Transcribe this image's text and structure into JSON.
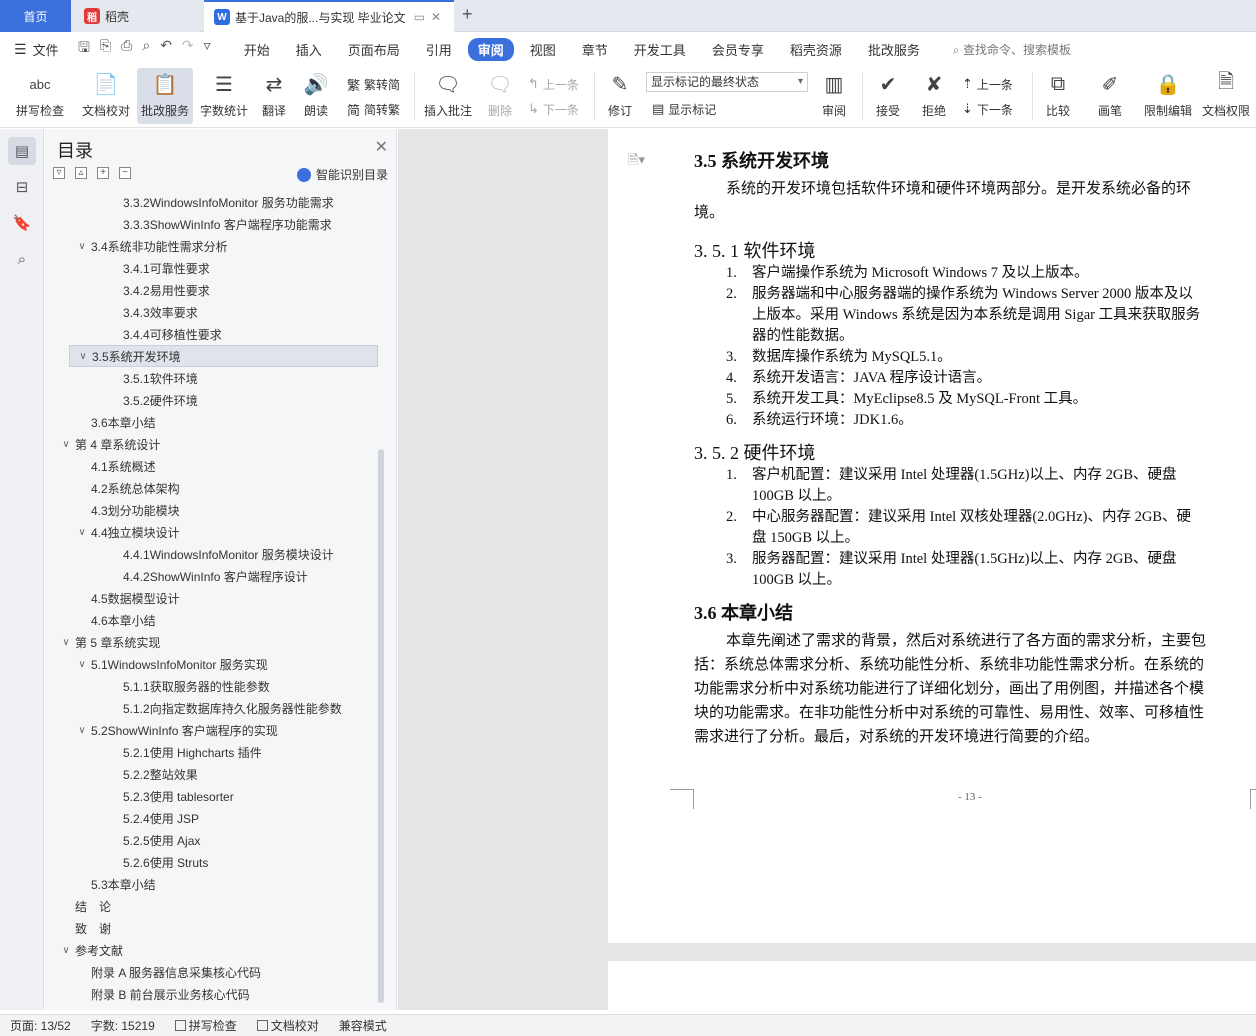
{
  "tabs": {
    "home": "首页",
    "daoke": "稻壳",
    "doc": "基于Java的服...与实现 毕业论文",
    "new_tab": "+"
  },
  "menubar": {
    "file": "文件",
    "items": [
      "开始",
      "插入",
      "页面布局",
      "引用",
      "审阅",
      "视图",
      "章节",
      "开发工具",
      "会员专享",
      "稻壳资源",
      "批改服务"
    ],
    "active": "审阅",
    "search": "查找命令、搜索模板"
  },
  "ribbon": {
    "spell_check": "拼写检查",
    "doc_proof": "文档校对",
    "correction": "批改服务",
    "word_count": "字数统计",
    "translate": "翻译",
    "read_aloud": "朗读",
    "to_traditional": "繁转简",
    "to_simplified": "简转繁",
    "insert_comment": "插入批注",
    "delete": "删除",
    "prev_comment": "上一条",
    "next_comment": "下一条",
    "revise": "修订",
    "markup_select": "显示标记的最终状态",
    "show_markup": "显示标记",
    "review": "审阅",
    "accept": "接受",
    "reject": "拒绝",
    "prev_change": "上一条",
    "next_change": "下一条",
    "compare": "比较",
    "pen": "画笔",
    "restrict_edit": "限制编辑",
    "doc_permission": "文档权限",
    "abc": "abc"
  },
  "toc": {
    "title": "目录",
    "ai_label": "智能识别目录",
    "items": [
      {
        "text": "3.3.2WindowsInfoMonitor 服务功能需求",
        "level": 3,
        "arrow": ""
      },
      {
        "text": "3.3.3ShowWinInfo 客户端程序功能需求",
        "level": 3,
        "arrow": ""
      },
      {
        "text": "3.4系统非功能性需求分析",
        "level": 2,
        "arrow": "v"
      },
      {
        "text": "3.4.1可靠性要求",
        "level": 3,
        "arrow": ""
      },
      {
        "text": "3.4.2易用性要求",
        "level": 3,
        "arrow": ""
      },
      {
        "text": "3.4.3效率要求",
        "level": 3,
        "arrow": ""
      },
      {
        "text": "3.4.4可移植性要求",
        "level": 3,
        "arrow": ""
      },
      {
        "text": "3.5系统开发环境",
        "level": 2,
        "arrow": "v",
        "selected": true
      },
      {
        "text": "3.5.1软件环境",
        "level": 3,
        "arrow": ""
      },
      {
        "text": "3.5.2硬件环境",
        "level": 3,
        "arrow": ""
      },
      {
        "text": "3.6本章小结",
        "level": 2,
        "arrow": ""
      },
      {
        "text": "第 4 章系统设计",
        "level": 1,
        "arrow": "v"
      },
      {
        "text": "4.1系统概述",
        "level": 2,
        "arrow": ""
      },
      {
        "text": "4.2系统总体架构",
        "level": 2,
        "arrow": ""
      },
      {
        "text": "4.3划分功能模块",
        "level": 2,
        "arrow": ""
      },
      {
        "text": "4.4独立模块设计",
        "level": 2,
        "arrow": "v"
      },
      {
        "text": "4.4.1WindowsInfoMonitor 服务模块设计",
        "level": 3,
        "arrow": ""
      },
      {
        "text": "4.4.2ShowWinInfo 客户端程序设计",
        "level": 3,
        "arrow": ""
      },
      {
        "text": "4.5数据模型设计",
        "level": 2,
        "arrow": ""
      },
      {
        "text": "4.6本章小结",
        "level": 2,
        "arrow": ""
      },
      {
        "text": "第 5 章系统实现",
        "level": 1,
        "arrow": "v"
      },
      {
        "text": "5.1WindowsInfoMonitor 服务实现",
        "level": 2,
        "arrow": "v"
      },
      {
        "text": "5.1.1获取服务器的性能参数",
        "level": 3,
        "arrow": ""
      },
      {
        "text": "5.1.2向指定数据库持久化服务器性能参数",
        "level": 3,
        "arrow": ""
      },
      {
        "text": "5.2ShowWinInfo 客户端程序的实现",
        "level": 2,
        "arrow": "v"
      },
      {
        "text": "5.2.1使用 Highcharts 插件",
        "level": 3,
        "arrow": ""
      },
      {
        "text": "5.2.2整站效果",
        "level": 3,
        "arrow": ""
      },
      {
        "text": "5.2.3使用 tablesorter",
        "level": 3,
        "arrow": ""
      },
      {
        "text": "5.2.4使用 JSP",
        "level": 3,
        "arrow": ""
      },
      {
        "text": "5.2.5使用 Ajax",
        "level": 3,
        "arrow": ""
      },
      {
        "text": "5.2.6使用 Struts",
        "level": 3,
        "arrow": ""
      },
      {
        "text": "5.3本章小结",
        "level": 2,
        "arrow": ""
      },
      {
        "text": "结　论",
        "level": 1,
        "arrow": ""
      },
      {
        "text": "致　谢",
        "level": 1,
        "arrow": ""
      },
      {
        "text": "参考文献",
        "level": 1,
        "arrow": "v"
      },
      {
        "text": "附录 A  服务器信息采集核心代码",
        "level": 2,
        "arrow": ""
      },
      {
        "text": "附录 B  前台展示业务核心代码",
        "level": 2,
        "arrow": ""
      }
    ]
  },
  "document": {
    "h_35": "3.5  系统开发环境",
    "p_35_line1": "系统的开发环境包括软件环境和硬件环境两部分。是开发系统必备的环",
    "p_35_line2": "境。",
    "h_351": "3. 5. 1  软件环境",
    "sw": [
      {
        "num": "1.",
        "lines": [
          "客户端操作系统为 Microsoft Windows 7 及以上版本。"
        ]
      },
      {
        "num": "2.",
        "lines": [
          "服务器端和中心服务器端的操作系统为 Windows Server 2000 版本及以",
          "上版本。采用 Windows 系统是因为本系统是调用 Sigar 工具来获取服务",
          "器的性能数据。"
        ]
      },
      {
        "num": "3.",
        "lines": [
          "数据库操作系统为 MySQL5.1。"
        ]
      },
      {
        "num": "4.",
        "lines": [
          "系统开发语言：JAVA 程序设计语言。"
        ]
      },
      {
        "num": "5.",
        "lines": [
          "系统开发工具：MyEclipse8.5 及 MySQL-Front 工具。"
        ]
      },
      {
        "num": "6.",
        "lines": [
          "系统运行环境：JDK1.6。"
        ]
      }
    ],
    "h_352": "3. 5. 2  硬件环境",
    "hw": [
      {
        "num": "1.",
        "lines": [
          "客户机配置：建议采用 Intel 处理器(1.5GHz)以上、内存 2GB、硬盘",
          "100GB 以上。"
        ]
      },
      {
        "num": "2.",
        "lines": [
          "中心服务器配置：建议采用 Intel 双核处理器(2.0GHz)、内存 2GB、硬",
          "盘 150GB 以上。"
        ]
      },
      {
        "num": "3.",
        "lines": [
          "服务器配置：建议采用 Intel 处理器(1.5GHz)以上、内存 2GB、硬盘",
          "100GB 以上。"
        ]
      }
    ],
    "h_36": "3.6  本章小结",
    "summary": [
      "本章先阐述了需求的背景，然后对系统进行了各方面的需求分析，主要包",
      "括：系统总体需求分析、系统功能性分析、系统非功能性需求分析。在系统的",
      "功能需求分析中对系统功能进行了详细化划分，画出了用例图，并描述各个模",
      "块的功能需求。在非功能性分析中对系统的可靠性、易用性、效率、可移植性",
      "需求进行了分析。最后，对系统的开发环境进行简要的介绍。"
    ],
    "page_number": "- 13 -"
  },
  "statusbar": {
    "page": "页面: 13/52",
    "words": "字数: 15219",
    "spell": "拼写检查",
    "proof": "文档校对",
    "compat": "兼容模式"
  },
  "colors": {
    "accent": "#3a6fdc",
    "tab_bg": "#e5e8ee",
    "doc_bg": "#e4e5e7"
  }
}
